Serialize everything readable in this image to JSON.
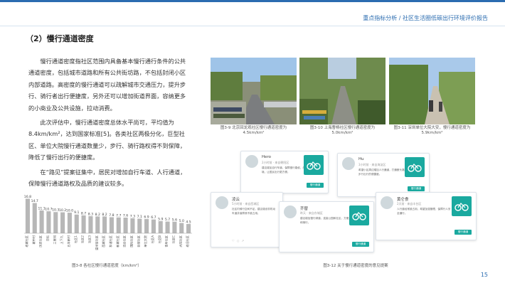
{
  "header": {
    "title": "重点指标分析 / 社区生活圈低碳出行环境评价报告"
  },
  "section": {
    "title": "（2）慢行通道密度"
  },
  "paragraphs": [
    "慢行通道密度指社区范围内具备基本慢行通行条件的公共通道密度，包括城市道路和所有公共街坊路，不包括封闭小区内部道路。高密度的慢行通道可以疏解城市交通压力，提升步行、骑行者出行便捷度，另外还可以增加街道界面，容纳更多的小商业及公共设施，拉动消费。",
    "此次评估中，慢行通道密度总体水平尚可，平均值为8.4km/km²，达到国家标准[5]。各类社区两极分化，巨型社区、单位大院慢行通道数量少，步行、骑行路权得不到保障，降低了慢行出行的便捷度。",
    "在“路见”提案征集中，居民对增加自行车道、人行通道，保障慢行通道路权及品质的建议较多。"
  ],
  "chart_data": {
    "type": "bar",
    "title": "",
    "categories": [
      "老城社区",
      "城中村",
      "历史社区",
      "日坛",
      "三里河",
      "上下九",
      "五羊新村",
      "社区1",
      "社区2",
      "社区3",
      "温州街社区",
      "西城社区",
      "和谐社区",
      "新城社区",
      "混合社区",
      "国际社区",
      "巨型社区",
      "单位大院",
      "社区A",
      "社区B",
      "青年社区",
      "社区C",
      "大院社区",
      "老旧社区",
      "综合社区",
      "新加坡社区"
    ],
    "values": [
      16.8,
      14.7,
      11.1,
      10.7,
      10.3,
      10.2,
      10.0,
      9.1,
      8.7,
      8.3,
      8.2,
      8.2,
      7.8,
      7.7,
      7.6,
      7.3,
      7.1,
      6.9,
      6.7,
      5.9,
      5.7,
      5.6,
      5.0,
      4.5
    ],
    "bar_color": "#b7b7b7",
    "ylim": [
      0,
      18
    ],
    "grid": false
  },
  "captions": {
    "chart": "图3-8 各社区慢行通道密度（km/km²）",
    "photo1": "图3-9 北京回龙观社区慢行通道密度为4.5km/km²",
    "photo2": "图3-10 上海曹杨社区慢行通道密度为5.0km/km²",
    "photo3": "图3-11 深圳单位大院大安，慢行通道密度为5.9km/km²",
    "comments": "图3-12 关于慢行通道密度的意见提案"
  },
  "comments": [
    {
      "user": "Hero",
      "time": "2小时前 · 来自朝阳区",
      "text": "建议增加自行车道，保障慢行路权，改善通行环境，让居民出行更方便。",
      "button": "慢行通道"
    },
    {
      "user": "Hu",
      "time": "3小时前 · 来自海淀区",
      "text": "希望小区周边增加人行通道，打通断头路，提升步行出行的便捷度。",
      "button": "慢行通道"
    },
    {
      "user": "凌云",
      "time": "5小时前 · 来自西城区",
      "text": "社区内骑行空间不足，建议增设非机动车道并保障其不被占用。",
      "button": "慢行通道"
    },
    {
      "user": "齐替",
      "time": "昨天 · 来自东城区",
      "text": "建议增加慢行绿道，连接公园和社区，方便步行和骑行。",
      "button": "慢行通道"
    },
    {
      "user": "黄仑食",
      "time": "2天前 · 来自丰台区",
      "text": "人行道经常被占用，希望加强管理，保障行人安全通行。",
      "button": "慢行通道"
    }
  ],
  "page_number": "15"
}
